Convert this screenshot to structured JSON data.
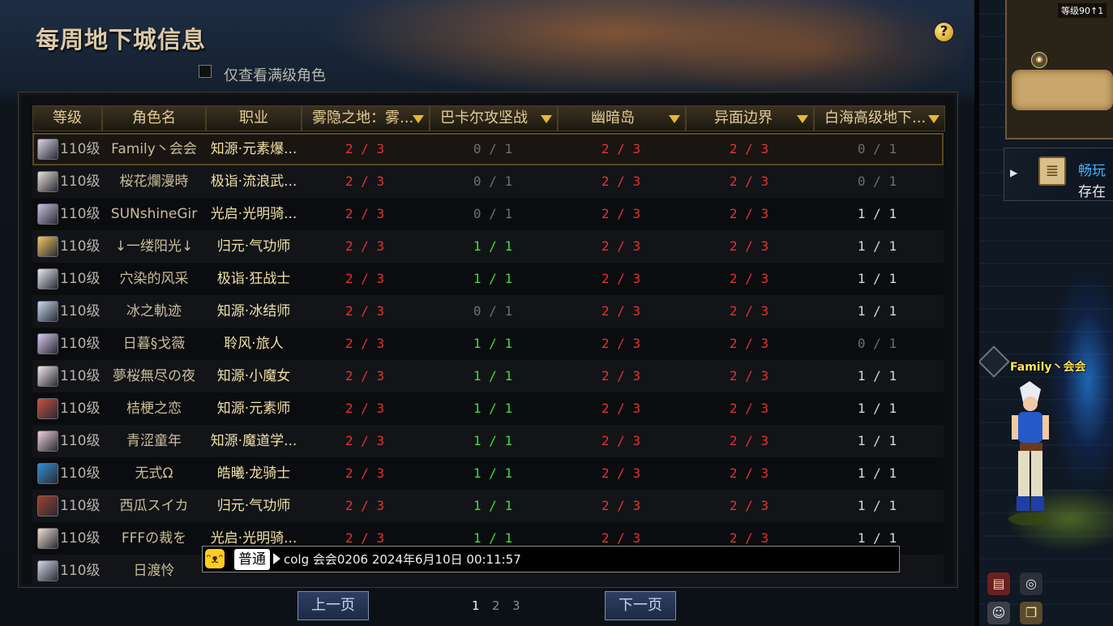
{
  "dialog": {
    "title": "每周地下城信息",
    "help": "?",
    "filter_label": "仅查看满级角色"
  },
  "columns": {
    "level": "等级",
    "name": "角色名",
    "job": "职业",
    "dungeons": [
      "雾隐之地：雾...",
      "巴卡尔攻坚战",
      "幽暗岛",
      "异面边界",
      "白海高级地下..."
    ]
  },
  "colors": {
    "red": "#dd3535",
    "green": "#38e038",
    "gray": "#6e6e6e",
    "white": "#d6d6d6"
  },
  "rows": [
    {
      "level": "110级",
      "name": "Family丶会会",
      "job": "知源·元素爆...",
      "d": [
        [
          "2 / 3",
          "red"
        ],
        [
          "0 / 1",
          "gray"
        ],
        [
          "2 / 3",
          "red"
        ],
        [
          "2 / 3",
          "red"
        ],
        [
          "0 / 1",
          "gray"
        ]
      ]
    },
    {
      "level": "110级",
      "name": "桜花爛漫時",
      "job": "极诣·流浪武...",
      "d": [
        [
          "2 / 3",
          "red"
        ],
        [
          "0 / 1",
          "gray"
        ],
        [
          "2 / 3",
          "red"
        ],
        [
          "2 / 3",
          "red"
        ],
        [
          "0 / 1",
          "gray"
        ]
      ]
    },
    {
      "level": "110级",
      "name": "SUNshineGir",
      "job": "光启·光明骑...",
      "d": [
        [
          "2 / 3",
          "red"
        ],
        [
          "0 / 1",
          "gray"
        ],
        [
          "2 / 3",
          "red"
        ],
        [
          "2 / 3",
          "red"
        ],
        [
          "1 / 1",
          "white"
        ]
      ]
    },
    {
      "level": "110级",
      "name": "↓一缕阳光↓",
      "job": "归元·气功师",
      "d": [
        [
          "2 / 3",
          "red"
        ],
        [
          "1 / 1",
          "green"
        ],
        [
          "2 / 3",
          "red"
        ],
        [
          "2 / 3",
          "red"
        ],
        [
          "1 / 1",
          "white"
        ]
      ]
    },
    {
      "level": "110级",
      "name": "穴染的风采",
      "job": "极诣·狂战士",
      "d": [
        [
          "2 / 3",
          "red"
        ],
        [
          "1 / 1",
          "green"
        ],
        [
          "2 / 3",
          "red"
        ],
        [
          "2 / 3",
          "red"
        ],
        [
          "1 / 1",
          "white"
        ]
      ]
    },
    {
      "level": "110级",
      "name": "冰之軌迹",
      "job": "知源·冰结师",
      "d": [
        [
          "2 / 3",
          "red"
        ],
        [
          "0 / 1",
          "gray"
        ],
        [
          "2 / 3",
          "red"
        ],
        [
          "2 / 3",
          "red"
        ],
        [
          "1 / 1",
          "white"
        ]
      ]
    },
    {
      "level": "110级",
      "name": "日暮§戈薇",
      "job": "聆风·旅人",
      "d": [
        [
          "2 / 3",
          "red"
        ],
        [
          "1 / 1",
          "green"
        ],
        [
          "2 / 3",
          "red"
        ],
        [
          "2 / 3",
          "red"
        ],
        [
          "0 / 1",
          "gray"
        ]
      ]
    },
    {
      "level": "110级",
      "name": "夢桜無尽の夜",
      "job": "知源·小魔女",
      "d": [
        [
          "2 / 3",
          "red"
        ],
        [
          "1 / 1",
          "green"
        ],
        [
          "2 / 3",
          "red"
        ],
        [
          "2 / 3",
          "red"
        ],
        [
          "1 / 1",
          "white"
        ]
      ]
    },
    {
      "level": "110级",
      "name": "桔梗之恋",
      "job": "知源·元素师",
      "d": [
        [
          "2 / 3",
          "red"
        ],
        [
          "1 / 1",
          "green"
        ],
        [
          "2 / 3",
          "red"
        ],
        [
          "2 / 3",
          "red"
        ],
        [
          "1 / 1",
          "white"
        ]
      ]
    },
    {
      "level": "110级",
      "name": "青涩童年",
      "job": "知源·魔道学...",
      "d": [
        [
          "2 / 3",
          "red"
        ],
        [
          "1 / 1",
          "green"
        ],
        [
          "2 / 3",
          "red"
        ],
        [
          "2 / 3",
          "red"
        ],
        [
          "1 / 1",
          "white"
        ]
      ]
    },
    {
      "level": "110级",
      "name": "无式Ω",
      "job": "皓曦·龙骑士",
      "d": [
        [
          "2 / 3",
          "red"
        ],
        [
          "1 / 1",
          "green"
        ],
        [
          "2 / 3",
          "red"
        ],
        [
          "2 / 3",
          "red"
        ],
        [
          "1 / 1",
          "white"
        ]
      ]
    },
    {
      "level": "110级",
      "name": "西瓜スイカ",
      "job": "归元·气功师",
      "d": [
        [
          "2 / 3",
          "red"
        ],
        [
          "1 / 1",
          "green"
        ],
        [
          "2 / 3",
          "red"
        ],
        [
          "2 / 3",
          "red"
        ],
        [
          "1 / 1",
          "white"
        ]
      ]
    },
    {
      "level": "110级",
      "name": "FFFの裁を",
      "job": "光启·光明骑...",
      "d": [
        [
          "2 / 3",
          "red"
        ],
        [
          "1 / 1",
          "green"
        ],
        [
          "2 / 3",
          "red"
        ],
        [
          "2 / 3",
          "red"
        ],
        [
          "1 / 1",
          "white"
        ]
      ]
    },
    {
      "level": "110级",
      "name": "日渡怜",
      "job": "",
      "d": [
        [
          "",
          "red"
        ],
        [
          "",
          "gray"
        ],
        [
          "",
          "red"
        ],
        [
          "",
          "red"
        ],
        [
          "",
          "white"
        ]
      ]
    }
  ],
  "chat": {
    "channel": "普通",
    "message": "colg 会会0206 2024年6月10日 00:11:57"
  },
  "pager": {
    "prev": "上一页",
    "next": "下一页",
    "pages": [
      "1",
      "2",
      "3"
    ],
    "current": "1"
  },
  "hud": {
    "minimap_level": "等级90↑1",
    "quest_line1": "畅玩",
    "quest_line2": "存在",
    "player_name": "Family丶会会"
  }
}
